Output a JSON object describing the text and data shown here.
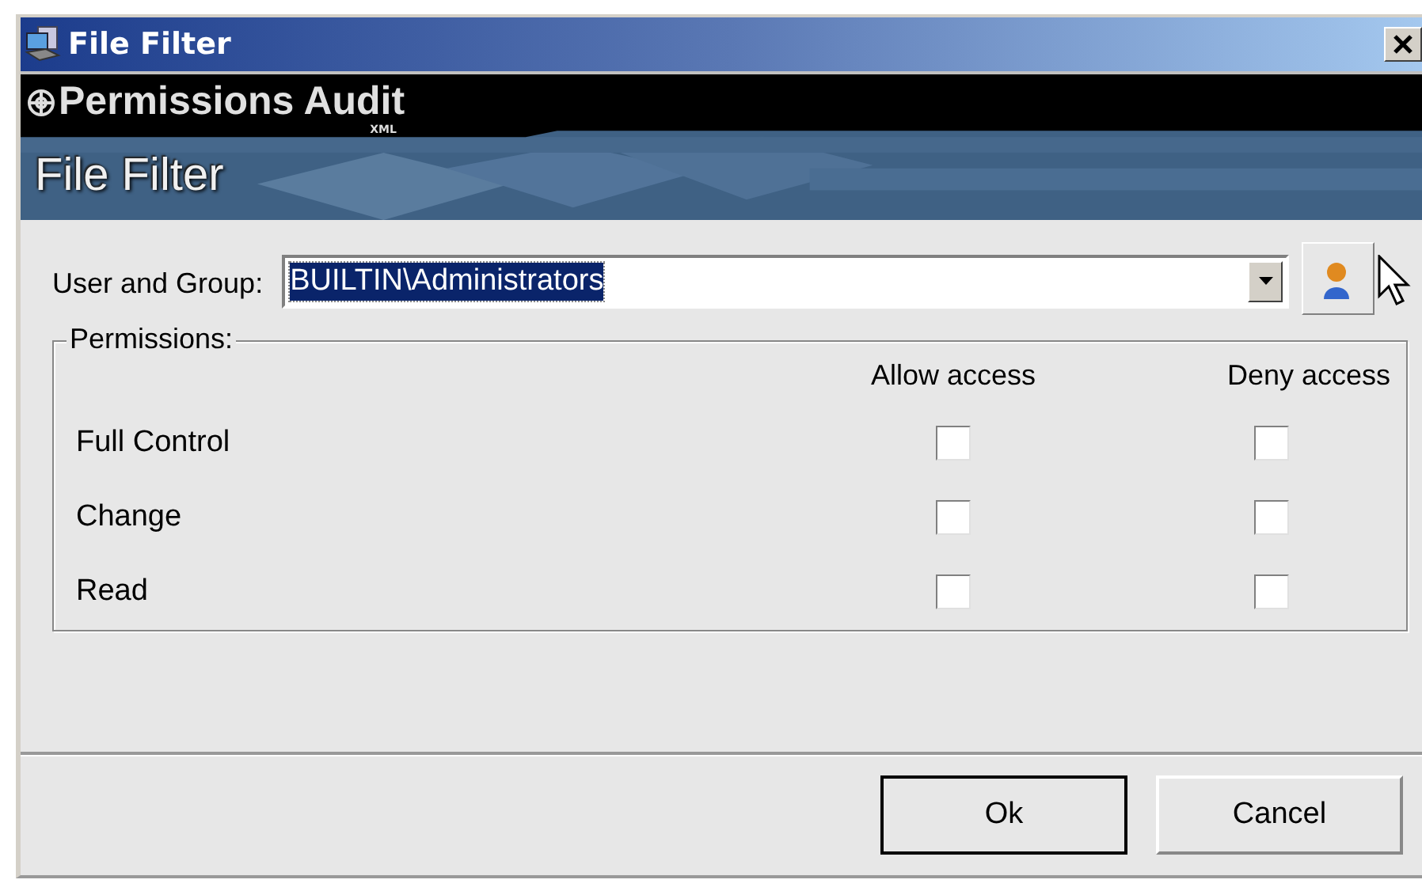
{
  "window": {
    "title": "File Filter"
  },
  "banner": {
    "product": "Permissions Audit",
    "edition": "XML",
    "heading": "File Filter"
  },
  "user_group": {
    "label": "User and Group:",
    "value": "BUILTIN\\Administrators",
    "highlighted": true
  },
  "permissions": {
    "title": "Permissions:",
    "columns": [
      "Allow access",
      "Deny access"
    ],
    "rows": [
      {
        "label": "Full Control",
        "allow": false,
        "deny": false
      },
      {
        "label": "Change",
        "allow": false,
        "deny": false
      },
      {
        "label": "Read",
        "allow": false,
        "deny": false
      }
    ]
  },
  "buttons": [
    {
      "label": "Ok",
      "default": true
    },
    {
      "label": "Cancel",
      "default": false
    }
  ]
}
